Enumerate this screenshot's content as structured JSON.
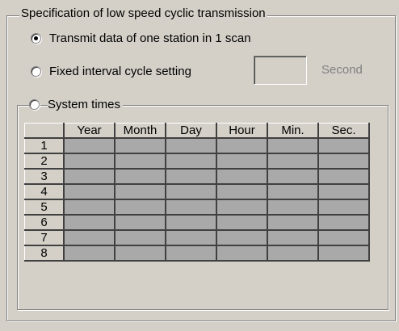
{
  "group_title": "Specification of low speed cyclic transmission",
  "options": {
    "one_station": "Transmit data of one station in 1 scan",
    "fixed_interval": "Fixed interval cycle setting",
    "system_times": "System times"
  },
  "selected_option": "one_station",
  "interval_value": "",
  "interval_unit": "Second",
  "table": {
    "columns": [
      "Year",
      "Month",
      "Day",
      "Hour",
      "Min.",
      "Sec."
    ],
    "rows": [
      "1",
      "2",
      "3",
      "4",
      "5",
      "6",
      "7",
      "8"
    ]
  }
}
